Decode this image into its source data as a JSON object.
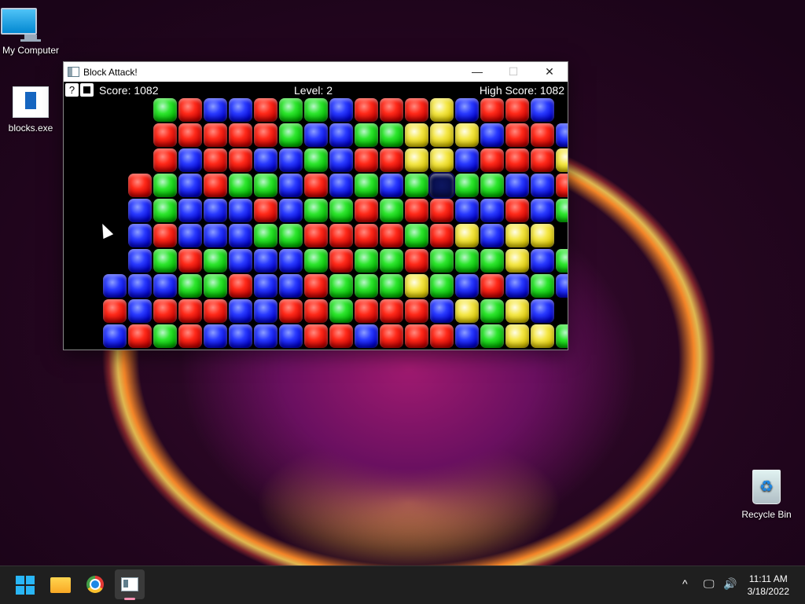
{
  "desktop": {
    "icons": [
      {
        "label": "My Computer"
      },
      {
        "label": "blocks.exe"
      },
      {
        "label": "Recycle Bin"
      }
    ]
  },
  "window": {
    "title": "Block Attack!",
    "controls": {
      "minimize": "—",
      "maximize": "☐",
      "close": "✕"
    }
  },
  "game": {
    "help_label": "?",
    "score_text": "Score: 1082",
    "level_text": "Level: 2",
    "high_score_text": "High Score: 1082",
    "colors": {
      "r": "#e01010",
      "b": "#1010e0",
      "g": "#10c010",
      "y": "#e0d020"
    },
    "board_rows": [
      ".....grbbrggbrrrybrrb",
      ".....rrrrrgbbggyyybrrb",
      ".....rbrrbbgbrryybrrry",
      "....rgbrggbrbgbgXggbbr",
      "....bgbbbrbggrgrrbbrbg",
      "....brbbbggrrrrgrybyy",
      "....bgrgbbbgrggrgggybg",
      "...bbbggrbbrgggygbrbgb",
      "...rbrrrbbrrgrrrbygyb",
      "...brgrbbbbrrbrrrbgyyg"
    ],
    "cursor_cell": {
      "row": 3,
      "col": 17
    }
  },
  "taskbar": {
    "tray_chevron": "^",
    "clock_time": "11:11 AM",
    "clock_date": "3/18/2022"
  }
}
